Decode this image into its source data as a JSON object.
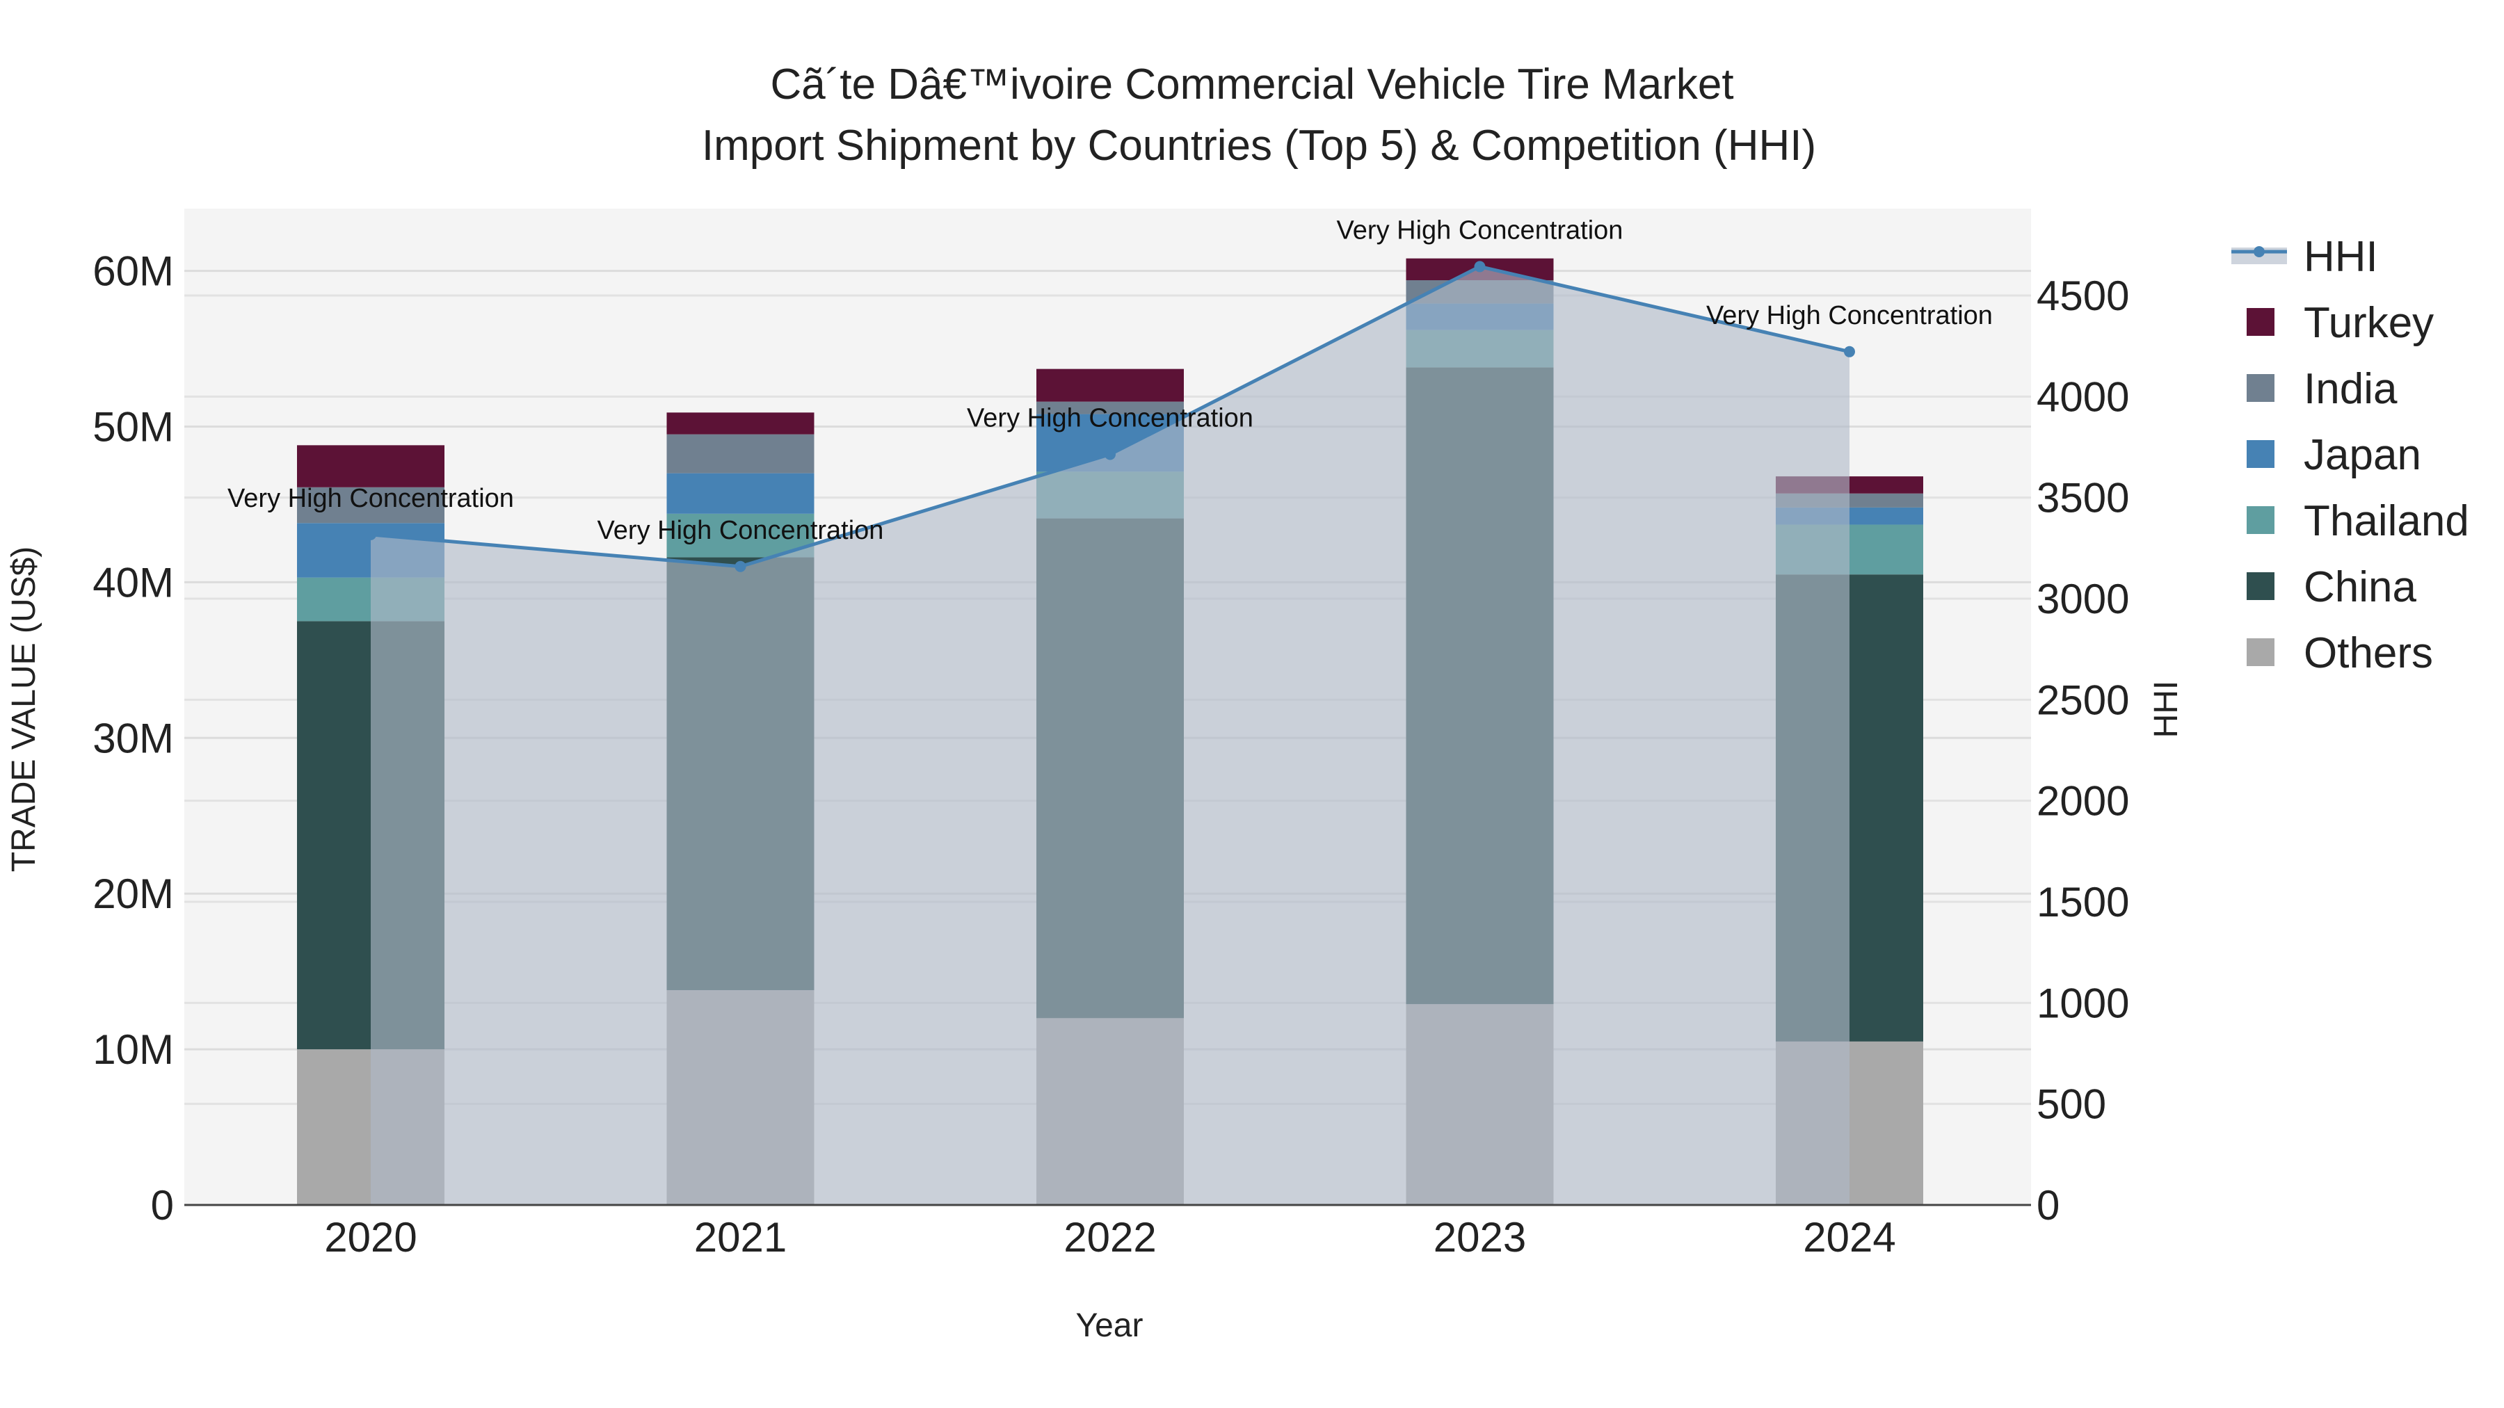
{
  "chart_data": {
    "type": "bar",
    "title": [
      "Cã´te Dâ€™ivoire Commercial Vehicle Tire Market",
      "Import Shipment by Countries (Top 5) & Competition (HHI)"
    ],
    "xlabel": "Year",
    "ylabel": "TRADE VALUE (US$)",
    "y2label": "HHI",
    "categories": [
      "2020",
      "2021",
      "2022",
      "2023",
      "2024"
    ],
    "ylim": [
      0,
      64
    ],
    "y_unit": "M",
    "y2lim": [
      0,
      4930
    ],
    "y_ticks": [
      {
        "v": 0,
        "label": "0"
      },
      {
        "v": 10,
        "label": "10M"
      },
      {
        "v": 20,
        "label": "20M"
      },
      {
        "v": 30,
        "label": "30M"
      },
      {
        "v": 40,
        "label": "40M"
      },
      {
        "v": 50,
        "label": "50M"
      },
      {
        "v": 60,
        "label": "60M"
      }
    ],
    "y2_ticks": [
      {
        "v": 0,
        "label": "0"
      },
      {
        "v": 500,
        "label": "500"
      },
      {
        "v": 1000,
        "label": "1000"
      },
      {
        "v": 1500,
        "label": "1500"
      },
      {
        "v": 2000,
        "label": "2000"
      },
      {
        "v": 2500,
        "label": "2500"
      },
      {
        "v": 3000,
        "label": "3000"
      },
      {
        "v": 3500,
        "label": "3500"
      },
      {
        "v": 4000,
        "label": "4000"
      },
      {
        "v": 4500,
        "label": "4500"
      }
    ],
    "series": [
      {
        "name": "Others",
        "color": "#A9A9A9",
        "values": [
          10.0,
          13.8,
          12.0,
          12.9,
          10.5
        ]
      },
      {
        "name": "China",
        "color": "#2F4F4F",
        "values": [
          27.5,
          27.8,
          32.1,
          40.9,
          30.0
        ]
      },
      {
        "name": "Thailand",
        "color": "#5F9EA0",
        "values": [
          2.8,
          2.8,
          3.0,
          2.4,
          3.2
        ]
      },
      {
        "name": "Japan",
        "color": "#4682B4",
        "values": [
          3.5,
          2.6,
          3.7,
          1.7,
          1.1
        ]
      },
      {
        "name": "India",
        "color": "#708090",
        "values": [
          2.3,
          2.5,
          0.8,
          1.5,
          0.9
        ]
      },
      {
        "name": "Turkey",
        "color": "#5C1236",
        "values": [
          2.7,
          1.4,
          2.1,
          1.4,
          1.1
        ]
      }
    ],
    "hhi": {
      "name": "HHI",
      "color": "#4682B4",
      "values": [
        3317,
        3159,
        3714,
        4643,
        4222
      ],
      "annotations": [
        "Very High Concentration",
        "Very High Concentration",
        "Very High Concentration",
        "Very High Concentration",
        "Very High Concentration"
      ]
    },
    "legend_order": [
      "HHI",
      "Turkey",
      "India",
      "Japan",
      "Thailand",
      "China",
      "Others"
    ],
    "legend_position": "right",
    "grid": true
  }
}
